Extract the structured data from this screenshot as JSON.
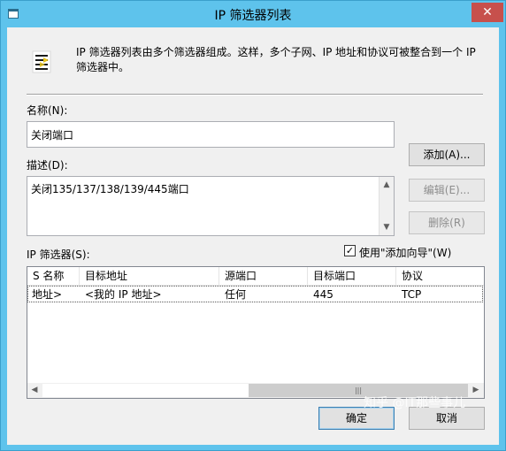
{
  "window": {
    "title": "IP 筛选器列表",
    "close_label": "✕"
  },
  "info": {
    "text_line1": "IP 筛选器列表由多个筛选器组成。这样，多个子网、IP 地址和协议可被整合到一个 IP",
    "text_line2": "筛选器中。"
  },
  "name_field": {
    "label": "名称(N):",
    "value": "关闭端口"
  },
  "desc_field": {
    "label": "描述(D):",
    "value": "关闭135/137/138/139/445端口"
  },
  "buttons": {
    "add": "添加(A)...",
    "edit": "编辑(E)...",
    "delete": "删除(R)",
    "ok": "确定",
    "cancel": "取消"
  },
  "filters": {
    "label": "IP 筛选器(S):",
    "wizard_label": "使用\"添加向导\"(W)",
    "wizard_checked": true,
    "columns": [
      "S 名称",
      "目标地址",
      "源端口",
      "目标端口",
      "协议"
    ],
    "rows": [
      [
        "地址>",
        "<我的 IP 地址>",
        "任何",
        "445",
        "TCP"
      ]
    ]
  },
  "watermark": "知乎 @IT那些事儿"
}
